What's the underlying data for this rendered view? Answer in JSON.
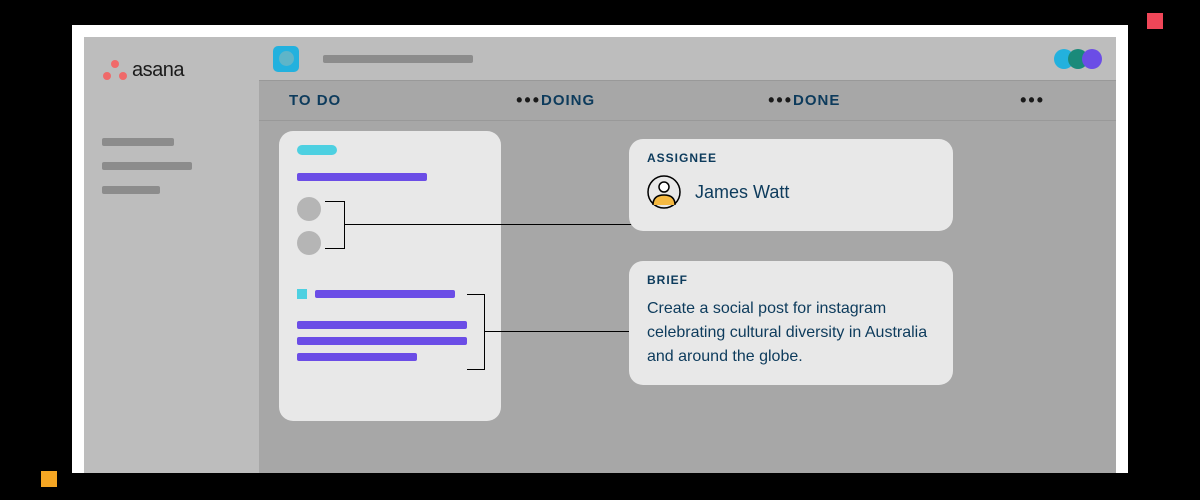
{
  "brand": {
    "name": "asana"
  },
  "sidebar": {
    "items": [
      "",
      "",
      ""
    ]
  },
  "project": {
    "title_placeholder": ""
  },
  "avatars": [
    "",
    "",
    ""
  ],
  "board": {
    "columns": [
      {
        "title": "TO DO"
      },
      {
        "title": "DOING"
      },
      {
        "title": "DONE"
      }
    ]
  },
  "callouts": {
    "assignee_label": "ASSIGNEE",
    "assignee_name": "James Watt",
    "brief_label": "BRIEF",
    "brief_text": "Create a social post for instagram celebrating cultural diversity in Australia and around the globe."
  },
  "colors": {
    "accent_red": "#ef4658",
    "accent_orange": "#f5a623",
    "accent_cyan": "#23B1DE",
    "accent_purple": "#6B4DE6",
    "brand_red": "#f06a6a",
    "navy_text": "#0d3b5c"
  }
}
